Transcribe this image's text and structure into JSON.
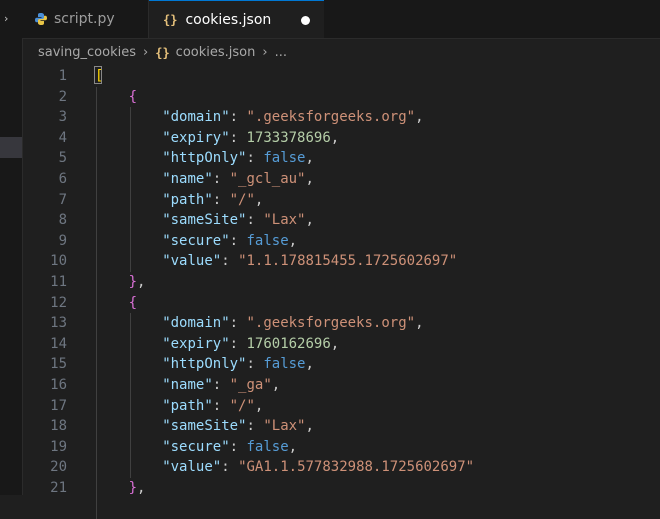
{
  "tabs": [
    {
      "label": "script.py",
      "icon": "python-icon"
    },
    {
      "label": "cookies.json",
      "icon": "json-icon"
    }
  ],
  "breadcrumb": {
    "folder": "saving_cookies",
    "file": "cookies.json",
    "more": "..."
  },
  "colors": {
    "key": "#9cdcfe",
    "string": "#ce9178",
    "number": "#b5cea8",
    "boolean": "#569cd6",
    "bracket_outer": "#ffd700",
    "bracket_inner": "#da70d6"
  },
  "lines": [
    {
      "num": "1",
      "indent": 0,
      "parts": [
        {
          "t": "[",
          "c": "br1"
        }
      ]
    },
    {
      "num": "2",
      "indent": 1,
      "parts": [
        {
          "t": "{",
          "c": "br2"
        }
      ]
    },
    {
      "num": "3",
      "indent": 2,
      "parts": [
        {
          "t": "\"domain\"",
          "c": "k"
        },
        {
          "t": ": ",
          "c": ""
        },
        {
          "t": "\".geeksforgeeks.org\"",
          "c": "s"
        },
        {
          "t": ",",
          "c": ""
        }
      ]
    },
    {
      "num": "4",
      "indent": 2,
      "parts": [
        {
          "t": "\"expiry\"",
          "c": "k"
        },
        {
          "t": ": ",
          "c": ""
        },
        {
          "t": "1733378696",
          "c": "n"
        },
        {
          "t": ",",
          "c": ""
        }
      ]
    },
    {
      "num": "5",
      "indent": 2,
      "parts": [
        {
          "t": "\"httpOnly\"",
          "c": "k"
        },
        {
          "t": ": ",
          "c": ""
        },
        {
          "t": "false",
          "c": "b"
        },
        {
          "t": ",",
          "c": ""
        }
      ]
    },
    {
      "num": "6",
      "indent": 2,
      "parts": [
        {
          "t": "\"name\"",
          "c": "k"
        },
        {
          "t": ": ",
          "c": ""
        },
        {
          "t": "\"_gcl_au\"",
          "c": "s"
        },
        {
          "t": ",",
          "c": ""
        }
      ]
    },
    {
      "num": "7",
      "indent": 2,
      "parts": [
        {
          "t": "\"path\"",
          "c": "k"
        },
        {
          "t": ": ",
          "c": ""
        },
        {
          "t": "\"/\"",
          "c": "s"
        },
        {
          "t": ",",
          "c": ""
        }
      ]
    },
    {
      "num": "8",
      "indent": 2,
      "parts": [
        {
          "t": "\"sameSite\"",
          "c": "k"
        },
        {
          "t": ": ",
          "c": ""
        },
        {
          "t": "\"Lax\"",
          "c": "s"
        },
        {
          "t": ",",
          "c": ""
        }
      ]
    },
    {
      "num": "9",
      "indent": 2,
      "parts": [
        {
          "t": "\"secure\"",
          "c": "k"
        },
        {
          "t": ": ",
          "c": ""
        },
        {
          "t": "false",
          "c": "b"
        },
        {
          "t": ",",
          "c": ""
        }
      ]
    },
    {
      "num": "10",
      "indent": 2,
      "parts": [
        {
          "t": "\"value\"",
          "c": "k"
        },
        {
          "t": ": ",
          "c": ""
        },
        {
          "t": "\"1.1.178815455.1725602697\"",
          "c": "s"
        }
      ]
    },
    {
      "num": "11",
      "indent": 1,
      "parts": [
        {
          "t": "}",
          "c": "br2"
        },
        {
          "t": ",",
          "c": ""
        }
      ]
    },
    {
      "num": "12",
      "indent": 1,
      "parts": [
        {
          "t": "{",
          "c": "br2"
        }
      ]
    },
    {
      "num": "13",
      "indent": 2,
      "parts": [
        {
          "t": "\"domain\"",
          "c": "k"
        },
        {
          "t": ": ",
          "c": ""
        },
        {
          "t": "\".geeksforgeeks.org\"",
          "c": "s"
        },
        {
          "t": ",",
          "c": ""
        }
      ]
    },
    {
      "num": "14",
      "indent": 2,
      "parts": [
        {
          "t": "\"expiry\"",
          "c": "k"
        },
        {
          "t": ": ",
          "c": ""
        },
        {
          "t": "1760162696",
          "c": "n"
        },
        {
          "t": ",",
          "c": ""
        }
      ]
    },
    {
      "num": "15",
      "indent": 2,
      "parts": [
        {
          "t": "\"httpOnly\"",
          "c": "k"
        },
        {
          "t": ": ",
          "c": ""
        },
        {
          "t": "false",
          "c": "b"
        },
        {
          "t": ",",
          "c": ""
        }
      ]
    },
    {
      "num": "16",
      "indent": 2,
      "parts": [
        {
          "t": "\"name\"",
          "c": "k"
        },
        {
          "t": ": ",
          "c": ""
        },
        {
          "t": "\"_ga\"",
          "c": "s"
        },
        {
          "t": ",",
          "c": ""
        }
      ]
    },
    {
      "num": "17",
      "indent": 2,
      "parts": [
        {
          "t": "\"path\"",
          "c": "k"
        },
        {
          "t": ": ",
          "c": ""
        },
        {
          "t": "\"/\"",
          "c": "s"
        },
        {
          "t": ",",
          "c": ""
        }
      ]
    },
    {
      "num": "18",
      "indent": 2,
      "parts": [
        {
          "t": "\"sameSite\"",
          "c": "k"
        },
        {
          "t": ": ",
          "c": ""
        },
        {
          "t": "\"Lax\"",
          "c": "s"
        },
        {
          "t": ",",
          "c": ""
        }
      ]
    },
    {
      "num": "19",
      "indent": 2,
      "parts": [
        {
          "t": "\"secure\"",
          "c": "k"
        },
        {
          "t": ": ",
          "c": ""
        },
        {
          "t": "false",
          "c": "b"
        },
        {
          "t": ",",
          "c": ""
        }
      ]
    },
    {
      "num": "20",
      "indent": 2,
      "parts": [
        {
          "t": "\"value\"",
          "c": "k"
        },
        {
          "t": ": ",
          "c": ""
        },
        {
          "t": "\"GA1.1.577832988.1725602697\"",
          "c": "s"
        }
      ]
    },
    {
      "num": "21",
      "indent": 1,
      "parts": [
        {
          "t": "}",
          "c": "br2"
        },
        {
          "t": ",",
          "c": ""
        }
      ]
    }
  ]
}
